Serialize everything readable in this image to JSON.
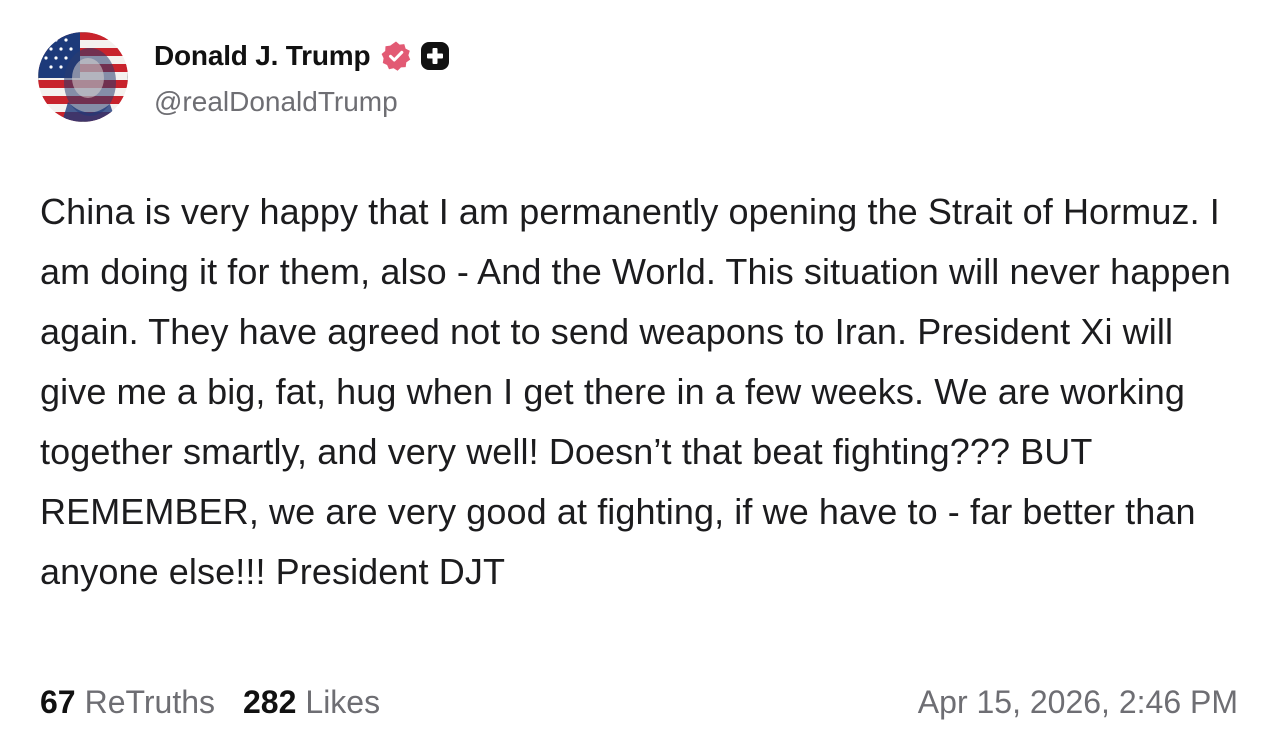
{
  "author": {
    "display_name": "Donald J. Trump",
    "handle": "@realDonaldTrump",
    "verified_badge_color": "#e25a74",
    "plus_badge_color": "#111111"
  },
  "post": {
    "text": "China is very happy that I am permanently opening the Strait of Hormuz. I am doing it for them, also - And the World. This situation will never happen again. They have agreed not to send weapons to Iran. President Xi will give me a big, fat, hug when I get there in a few weeks. We are working together smartly, and very well! Doesn’t that beat fighting??? BUT REMEMBER, we are very good at fighting, if we have to - far better than anyone else!!! President DJT"
  },
  "stats": {
    "retruths_count": "67",
    "retruths_label": "ReTruths",
    "likes_count": "282",
    "likes_label": "Likes"
  },
  "timestamp": "Apr 15, 2026, 2:46 PM"
}
